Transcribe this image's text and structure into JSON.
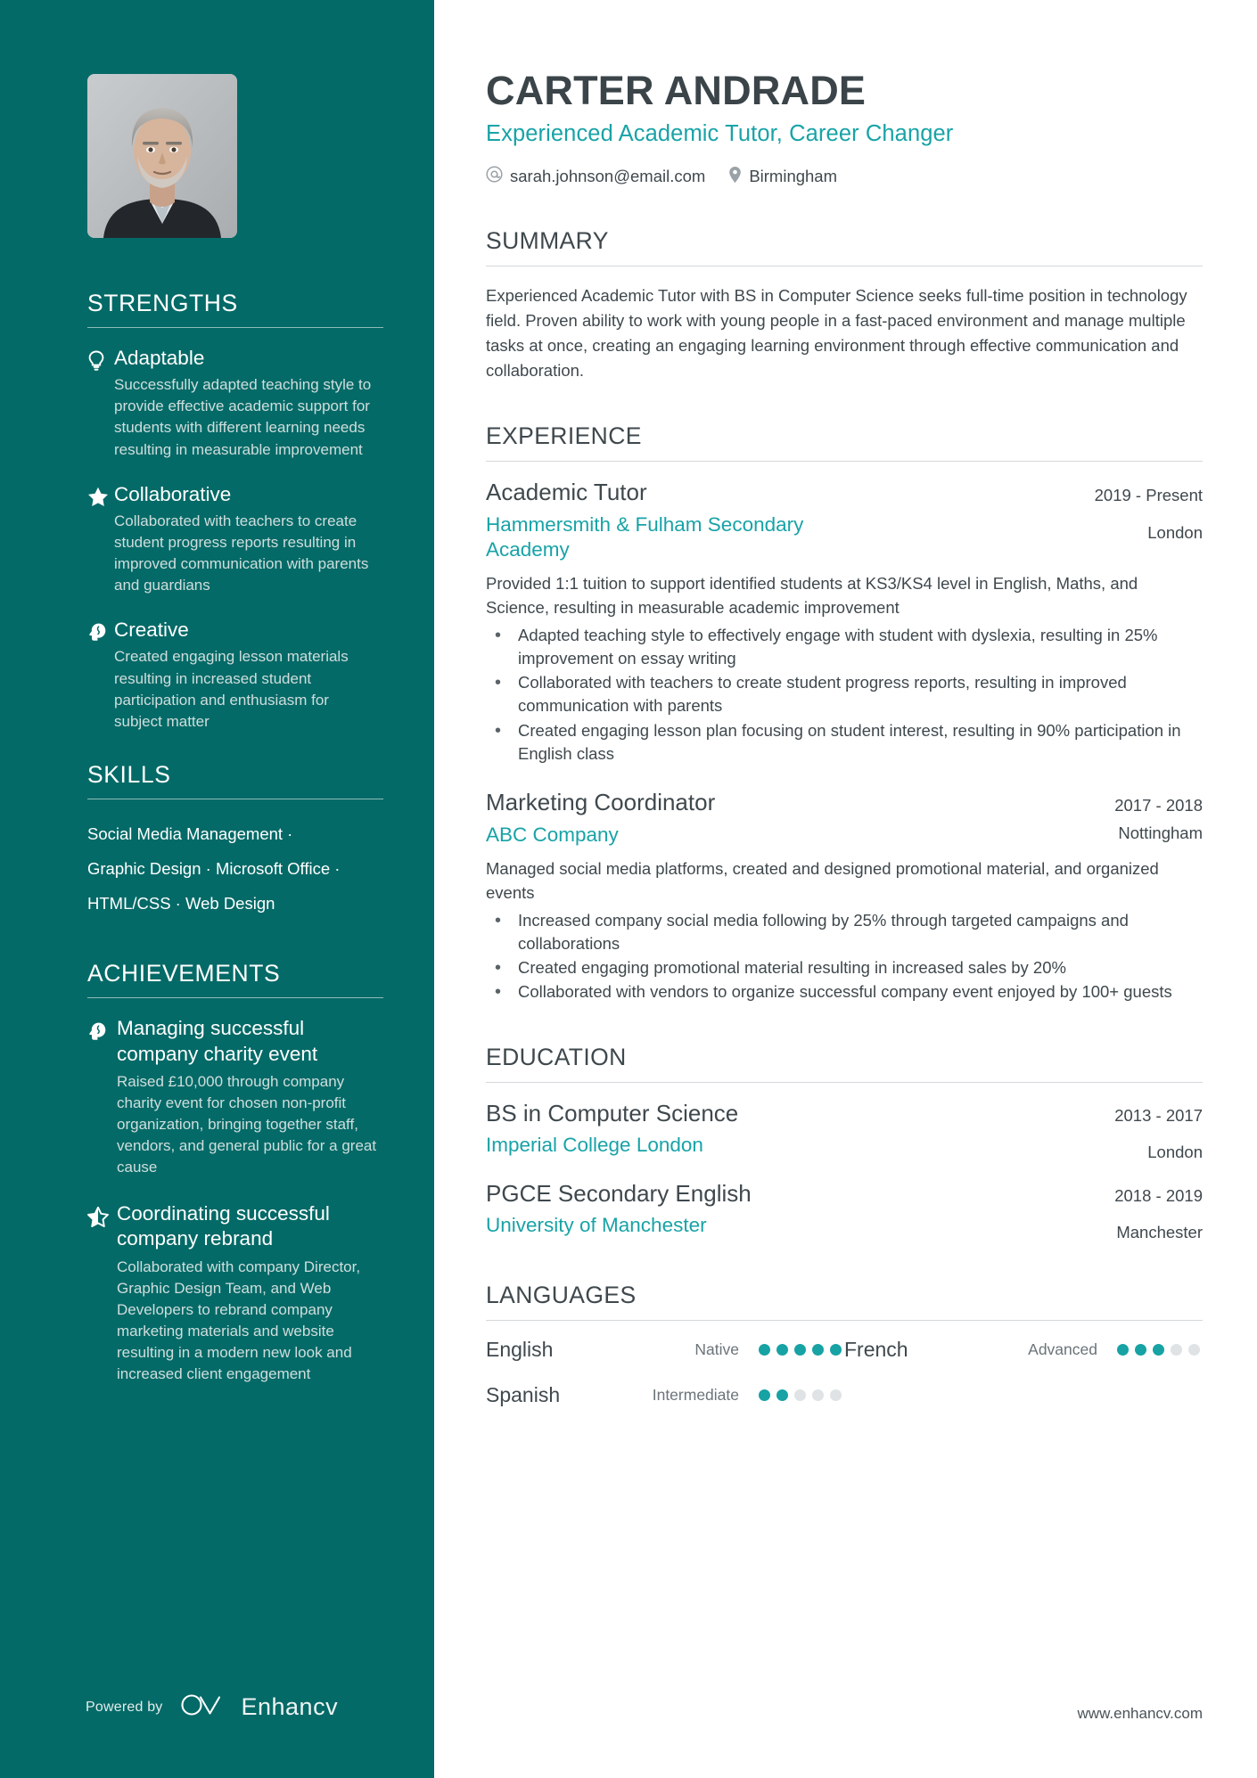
{
  "header": {
    "name": "CARTER ANDRADE",
    "role": "Experienced Academic Tutor, Career Changer",
    "email": "sarah.johnson@email.com",
    "location": "Birmingham",
    "email_icon": "at-sign-icon",
    "location_icon": "map-pin-icon"
  },
  "theme": {
    "sidebar_bg": "#046A67",
    "accent": "#18A3A7",
    "text": "#3f484d",
    "muted": "#cfdedd"
  },
  "sidebar": {
    "strengths": {
      "heading": "STRENGTHS",
      "items": [
        {
          "icon": "lightbulb-icon",
          "title": "Adaptable",
          "desc": "Successfully adapted teaching style to provide effective academic support for students with different learning needs resulting in measurable improvement"
        },
        {
          "icon": "star-icon",
          "title": "Collaborative",
          "desc": "Collaborated with teachers to create student progress reports resulting in improved communication with parents and guardians"
        },
        {
          "icon": "head-brain-icon",
          "title": "Creative",
          "desc": "Created engaging lesson materials resulting in increased student participation and enthusiasm for subject matter"
        }
      ]
    },
    "skills": {
      "heading": "SKILLS",
      "lines": [
        "Social Media Management ·",
        "Graphic Design · Microsoft Office ·",
        "HTML/CSS · Web Design"
      ]
    },
    "achievements": {
      "heading": "ACHIEVEMENTS",
      "items": [
        {
          "icon": "head-brain-icon",
          "title": "Managing successful company charity event",
          "desc": "Raised £10,000 through company charity event for chosen non-profit organization, bringing together staff, vendors, and general public for a great cause"
        },
        {
          "icon": "star-half-icon",
          "title": "Coordinating successful company rebrand",
          "desc": "Collaborated with company Director, Graphic Design Team, and Web Developers to rebrand company marketing materials and website resulting in a modern new look and increased client engagement"
        }
      ]
    },
    "footer": {
      "powered_by": "Powered by",
      "brand": "Enhancv",
      "brand_icon": "enhancv-logo-icon"
    }
  },
  "main": {
    "summary": {
      "heading": "SUMMARY",
      "text": "Experienced Academic Tutor with BS in Computer Science seeks full-time position in technology field. Proven ability to work with young people in a fast-paced environment and manage multiple tasks at once, creating an engaging learning environment through effective communication and collaboration."
    },
    "experience": {
      "heading": "EXPERIENCE",
      "jobs": [
        {
          "title": "Academic Tutor",
          "organization": "Hammersmith & Fulham Secondary Academy",
          "date": "2019 - Present",
          "location": "London",
          "description": "Provided 1:1 tuition to support identified students at KS3/KS4 level in English, Maths, and Science, resulting in measurable academic improvement",
          "bullets": [
            "Adapted teaching style to effectively engage with student with dyslexia, resulting in 25% improvement on essay writing",
            "Collaborated with teachers to create student progress reports, resulting in improved communication with parents",
            "Created engaging lesson plan focusing on student interest, resulting in 90% participation in English class"
          ]
        },
        {
          "title": "Marketing Coordinator",
          "organization": "ABC Company",
          "date": "2017 - 2018",
          "location": "Nottingham",
          "description": "Managed social media platforms, created and designed promotional material, and organized events",
          "bullets": [
            "Increased company social media following by 25% through targeted campaigns and collaborations",
            "Created engaging promotional material resulting in increased sales by 20%",
            "Collaborated with vendors to organize successful company event enjoyed by 100+ guests"
          ]
        }
      ]
    },
    "education": {
      "heading": "EDUCATION",
      "entries": [
        {
          "degree": "BS in Computer Science",
          "school": "Imperial College London",
          "date": "2013 - 2017",
          "location": "London"
        },
        {
          "degree": "PGCE Secondary English",
          "school": "University of Manchester",
          "date": "2018 - 2019",
          "location": "Manchester"
        }
      ]
    },
    "languages": {
      "heading": "LANGUAGES",
      "items": [
        {
          "name": "English",
          "level": "Native",
          "filled": 5,
          "total": 5
        },
        {
          "name": "French",
          "level": "Advanced",
          "filled": 3,
          "total": 5
        },
        {
          "name": "Spanish",
          "level": "Intermediate",
          "filled": 2,
          "total": 5
        }
      ]
    },
    "footer_url": "www.enhancv.com"
  }
}
